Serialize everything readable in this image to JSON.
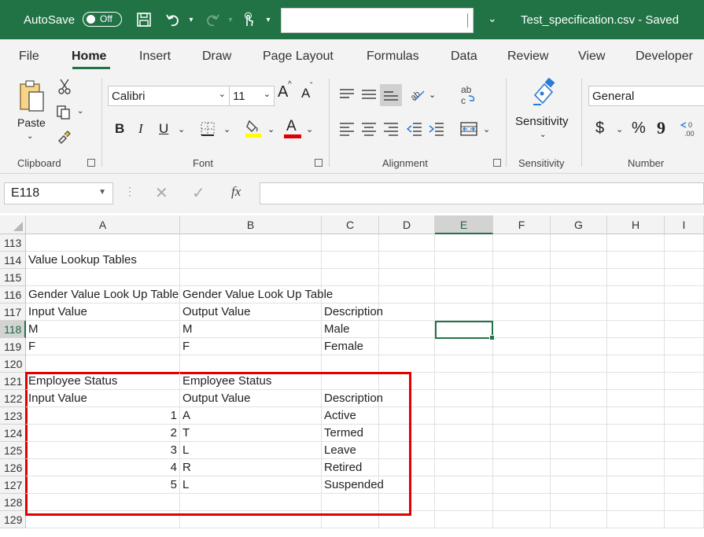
{
  "titlebar": {
    "autosave_label": "AutoSave",
    "toggle_state": "Off",
    "filename": "Test_specification.csv  -  Saved",
    "search_value": ""
  },
  "tabs": [
    "File",
    "Home",
    "Insert",
    "Draw",
    "Page Layout",
    "Formulas",
    "Data",
    "Review",
    "View",
    "Developer"
  ],
  "active_tab": "Home",
  "ribbon": {
    "clipboard": {
      "paste_label": "Paste",
      "group_label": "Clipboard"
    },
    "font": {
      "font_name": "Calibri",
      "font_size": "11",
      "group_label": "Font",
      "bold": "B",
      "italic": "I",
      "underline": "U",
      "grow": "A",
      "shrink": "A",
      "font_color_letter": "A"
    },
    "alignment": {
      "group_label": "Alignment",
      "wrap_label": "ab"
    },
    "sensitivity": {
      "label": "Sensitivity",
      "group_label": "Sensitivity"
    },
    "number": {
      "format": "General",
      "group_label": "Number",
      "currency": "$",
      "percent": "%",
      "comma": "9"
    }
  },
  "formula_bar": {
    "name_box": "E118",
    "fx_label": "fx",
    "value": ""
  },
  "columns": [
    "A",
    "B",
    "C",
    "D",
    "E",
    "F",
    "G",
    "H",
    "I"
  ],
  "selected_column": "E",
  "selected_row": "118",
  "rows": [
    {
      "num": "113",
      "a": "",
      "a_num": false,
      "b": "",
      "c": ""
    },
    {
      "num": "114",
      "a": "Value Lookup Tables",
      "a_num": false,
      "b": "",
      "c": ""
    },
    {
      "num": "115",
      "a": "",
      "a_num": false,
      "b": "",
      "c": ""
    },
    {
      "num": "116",
      "a": "Gender Value Look Up Table",
      "a_num": false,
      "b": "Gender Value Look Up Table",
      "c": ""
    },
    {
      "num": "117",
      "a": "Input Value",
      "a_num": false,
      "b": "Output Value",
      "c": "Description"
    },
    {
      "num": "118",
      "a": "M",
      "a_num": false,
      "b": "M",
      "c": "Male"
    },
    {
      "num": "119",
      "a": "F",
      "a_num": false,
      "b": "F",
      "c": "Female"
    },
    {
      "num": "120",
      "a": "",
      "a_num": false,
      "b": "",
      "c": ""
    },
    {
      "num": "121",
      "a": "Employee Status",
      "a_num": false,
      "b": "Employee Status",
      "c": ""
    },
    {
      "num": "122",
      "a": "Input Value",
      "a_num": false,
      "b": "Output Value",
      "c": "Description"
    },
    {
      "num": "123",
      "a": "1",
      "a_num": true,
      "b": "A",
      "c": "Active"
    },
    {
      "num": "124",
      "a": "2",
      "a_num": true,
      "b": "T",
      "c": "Termed"
    },
    {
      "num": "125",
      "a": "3",
      "a_num": true,
      "b": "L",
      "c": "Leave"
    },
    {
      "num": "126",
      "a": "4",
      "a_num": true,
      "b": "R",
      "c": "Retired"
    },
    {
      "num": "127",
      "a": "5",
      "a_num": true,
      "b": "L",
      "c": "Suspended"
    },
    {
      "num": "128",
      "a": "",
      "a_num": false,
      "b": "",
      "c": ""
    },
    {
      "num": "129",
      "a": "",
      "a_num": false,
      "b": "",
      "c": ""
    }
  ],
  "colors": {
    "excel_green": "#217346",
    "highlight_red": "#e00000"
  }
}
